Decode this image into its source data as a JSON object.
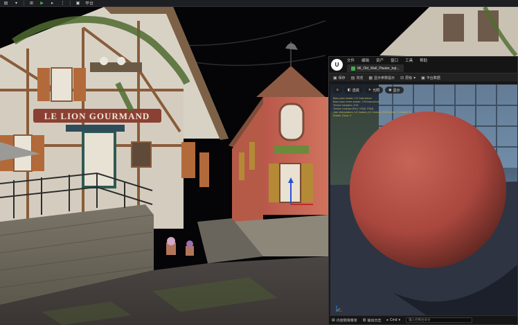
{
  "toolbar": {
    "icons": [
      {
        "name": "save-icon",
        "glyph": "▤"
      },
      {
        "name": "mode-icon",
        "glyph": "▾"
      },
      {
        "name": "snap-icon",
        "glyph": "⊞"
      },
      {
        "name": "play-icon",
        "glyph": "▶"
      },
      {
        "name": "step-icon",
        "glyph": "▸"
      },
      {
        "name": "options-icon",
        "glyph": "⋮"
      },
      {
        "name": "platforms-icon",
        "glyph": "▣"
      }
    ],
    "platforms_label": "平台"
  },
  "scene": {
    "sign_text": "LE LION GOURMAND",
    "colors": {
      "sky": "#050507",
      "plaster": "#d8d2c5",
      "timber": "#8a5c3a",
      "red_building": "#c4614e",
      "roof": "#8e5a44",
      "stone_wall": "#6f6a5e",
      "cobblestone": "#5a5450",
      "sign": "#8b4034",
      "ivy": "#4f6b2f"
    }
  },
  "material_editor": {
    "menu": [
      "文件",
      "编辑",
      "资产",
      "窗口",
      "工具",
      "帮助"
    ],
    "tab_label": "MI_Old_Wall_Plaster_bqt...",
    "toolbar": [
      {
        "icon": "save-icon",
        "glyph": "▣",
        "label": "保存"
      },
      {
        "icon": "browse-icon",
        "glyph": "▤",
        "label": "浏览"
      },
      {
        "icon": "parameters-icon",
        "glyph": "▦",
        "label": "显示参数提示"
      },
      {
        "icon": "hierarchy-icon",
        "glyph": "⊟",
        "label": "层级"
      },
      {
        "icon": "platform-stats-icon",
        "glyph": "▣",
        "label": "平台数据"
      }
    ],
    "preview_options": [
      {
        "icon": "menu-icon",
        "glyph": "≡",
        "label": ""
      },
      {
        "icon": "perspective-icon",
        "glyph": "◧",
        "label": "透视"
      },
      {
        "icon": "lit-icon",
        "glyph": "☀",
        "label": "光照"
      },
      {
        "icon": "show-icon",
        "glyph": "◉",
        "label": "显示"
      }
    ],
    "stats": [
      "Base pass shader: 127 instructions",
      "Base pass vertex shader: 178 instructions",
      "Texture samplers: 3/16",
      "Texture Lookups (Est.): VS(0), PS(4)",
      "User interpolators: 2/4 Scalars (1/4 Vectors) (TexCoords: 2, Custom: 0)",
      "Shader Count: 9"
    ],
    "statusbar": [
      {
        "icon": "content-drawer-icon",
        "glyph": "▤",
        "label": "内容侧滑菜单"
      },
      {
        "icon": "output-log-icon",
        "glyph": "▥",
        "label": "输出日志"
      },
      {
        "icon": "cmd-icon",
        "glyph": "▸",
        "label": "Cmd"
      }
    ],
    "cmd_placeholder": "输入控制台命令",
    "colors": {
      "sphere": "#a9473e",
      "floor": "#2e3442",
      "sky_preview": "#8fb3d6"
    }
  }
}
